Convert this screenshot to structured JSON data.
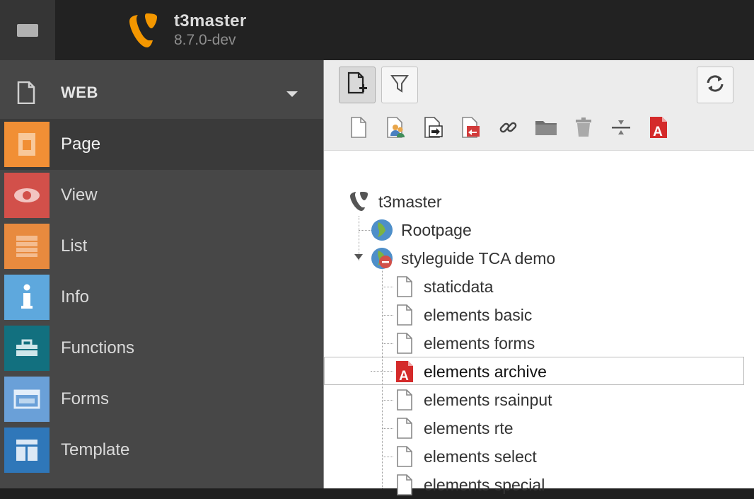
{
  "topbar": {
    "site_name": "t3master",
    "version": "8.7.0-dev",
    "logo_icon": "typo3-logo-icon",
    "menu_icon": "module-menu-toggle-icon",
    "tree_icon": "pagetree-toggle-icon",
    "brand_color": "#f49700"
  },
  "modmenu": {
    "group": {
      "label": "WEB",
      "icon": "page-document-icon"
    },
    "items": [
      {
        "label": "Page",
        "icon": "page-module-icon",
        "color": "#f18f35",
        "active": true
      },
      {
        "label": "View",
        "icon": "eye-icon",
        "color": "#d2504a",
        "active": false
      },
      {
        "label": "List",
        "icon": "list-icon",
        "color": "#e88a3e",
        "active": false
      },
      {
        "label": "Info",
        "icon": "info-icon",
        "color": "#5ea8dd",
        "active": false
      },
      {
        "label": "Functions",
        "icon": "toolbox-icon",
        "color": "#12707f",
        "active": false
      },
      {
        "label": "Forms",
        "icon": "forms-icon",
        "color": "#6aa0d8",
        "active": false
      },
      {
        "label": "Template",
        "icon": "template-icon",
        "color": "#2f77b9",
        "active": false
      }
    ]
  },
  "panel": {
    "toolbar": {
      "new_page_icon": "new-page-icon",
      "filter_icon": "filter-icon",
      "refresh_icon": "refresh-icon",
      "dnd_icons": [
        "doktype-page-icon",
        "doktype-backend-user-icon",
        "doktype-shortcut-icon",
        "doktype-mountpoint-icon",
        "doktype-link-icon",
        "doktype-folder-icon",
        "doktype-recycler-icon",
        "doktype-spacer-icon",
        "doktype-archive-icon"
      ]
    },
    "tree": {
      "root": "t3master",
      "nodes": [
        {
          "label": "Rootpage",
          "icon": "globe-icon"
        },
        {
          "label": "styleguide TCA demo",
          "icon": "globe-hidden-icon"
        },
        {
          "label": "staticdata",
          "icon": "page-icon"
        },
        {
          "label": "elements basic",
          "icon": "page-icon"
        },
        {
          "label": "elements forms",
          "icon": "page-icon"
        },
        {
          "label": "elements archive",
          "icon": "archive-icon"
        },
        {
          "label": "elements rsainput",
          "icon": "page-icon"
        },
        {
          "label": "elements rte",
          "icon": "page-icon"
        },
        {
          "label": "elements select",
          "icon": "page-icon"
        },
        {
          "label": "elements special",
          "icon": "page-icon"
        }
      ]
    }
  }
}
